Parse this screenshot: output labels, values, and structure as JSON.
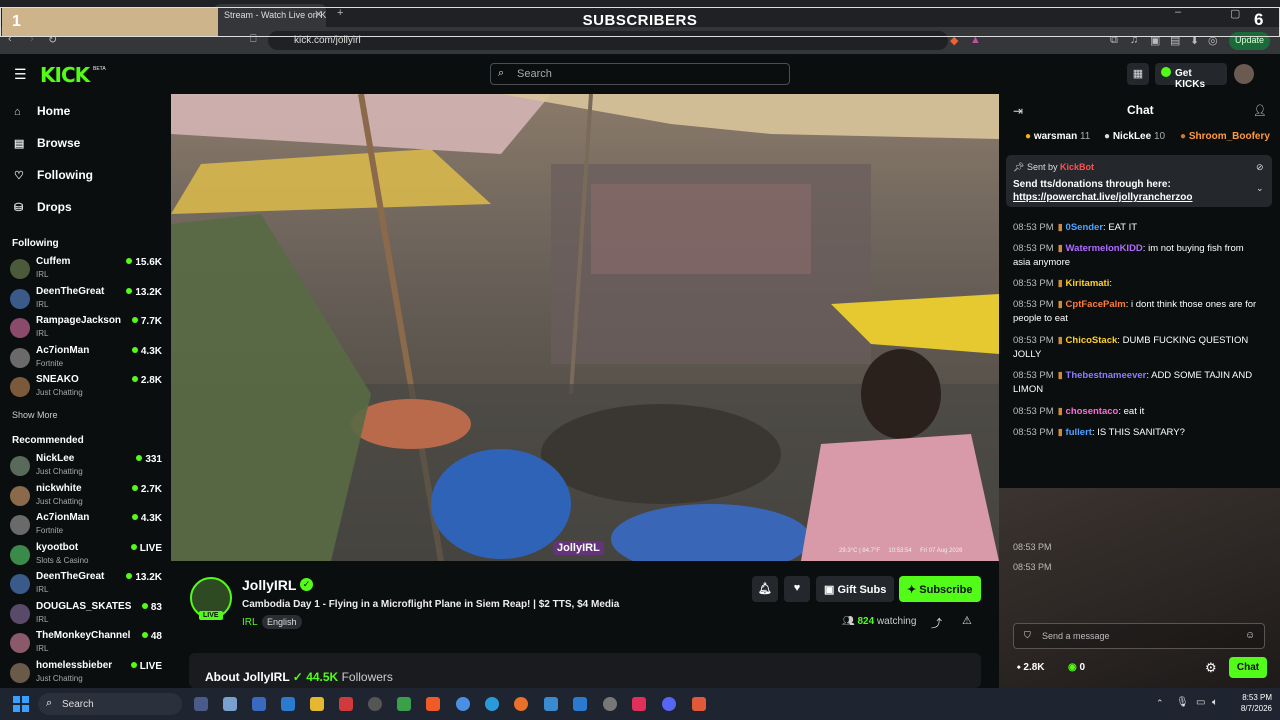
{
  "overlay": {
    "left_number": "1",
    "title": "SUBSCRIBERS",
    "right_number": "6"
  },
  "browser": {
    "tab_title": "Stream - Watch Live on K",
    "url": "kick.com/jollyirl",
    "update_label": "Update"
  },
  "header": {
    "logo": "KICK",
    "logo_badge": "BETA",
    "search_placeholder": "Search",
    "get_kicks_label": "Get KICKs"
  },
  "sidebar": {
    "nav": [
      {
        "label": "Home",
        "icon": "home-icon"
      },
      {
        "label": "Browse",
        "icon": "browse-icon"
      },
      {
        "label": "Following",
        "icon": "heart-icon"
      },
      {
        "label": "Drops",
        "icon": "drops-icon"
      }
    ],
    "following_title": "Following",
    "following": [
      {
        "name": "Cuffem",
        "category": "IRL",
        "viewers": "15.6K",
        "color": "#4a5a3a"
      },
      {
        "name": "DeenTheGreat",
        "category": "IRL",
        "viewers": "13.2K",
        "color": "#3a5a8a"
      },
      {
        "name": "RampageJackson",
        "category": "IRL",
        "viewers": "7.7K",
        "color": "#8a4a6a"
      },
      {
        "name": "Ac7ionMan",
        "category": "Fortnite",
        "viewers": "4.3K",
        "color": "#6a6a6a"
      },
      {
        "name": "SNEAKO",
        "category": "Just Chatting",
        "viewers": "2.8K",
        "color": "#7a5a3a"
      }
    ],
    "show_more": "Show More",
    "recommended_title": "Recommended",
    "recommended": [
      {
        "name": "NickLee",
        "category": "Just Chatting",
        "viewers": "331",
        "color": "#5a6a5a"
      },
      {
        "name": "nickwhite",
        "category": "Just Chatting",
        "viewers": "2.7K",
        "color": "#8a6a4a"
      },
      {
        "name": "Ac7ionMan",
        "category": "Fortnite",
        "viewers": "4.3K",
        "color": "#6a6a6a"
      },
      {
        "name": "kyootbot",
        "category": "Slots & Casino",
        "viewers": "LIVE",
        "color": "#3a8a4a"
      },
      {
        "name": "DeenTheGreat",
        "category": "IRL",
        "viewers": "13.2K",
        "color": "#3a5a8a"
      },
      {
        "name": "DOUGLAS_SKATES",
        "category": "IRL",
        "viewers": "83",
        "color": "#5a4a6a"
      },
      {
        "name": "TheMonkeyChannel",
        "category": "IRL",
        "viewers": "48",
        "color": "#8a5a6a"
      },
      {
        "name": "homelessbieber",
        "category": "Just Chatting",
        "viewers": "LIVE",
        "color": "#6a5a4a"
      }
    ]
  },
  "video": {
    "watermark": "JollyIRL",
    "overlay_info": "29.3°C | 84.7°F     10:53:54     Fri 07 Aug 2026"
  },
  "stream": {
    "streamer": "JollyIRL",
    "live_badge": "LIVE",
    "title": "Cambodia Day 1 - Flying in a Microflight Plane in Siem Reap! | $2 TTS, $4 Media",
    "category": "IRL",
    "language": "English",
    "gift_subs_label": "Gift Subs",
    "subscribe_label": "Subscribe",
    "watching_count": "824",
    "watching_label": "watching",
    "about_label": "About JollyIRL",
    "followers_count": "44.5K",
    "followers_label": "Followers"
  },
  "chat": {
    "title": "Chat",
    "top_gifters": [
      {
        "name": "warsman",
        "count": "11"
      },
      {
        "name": "NickLee",
        "count": "10"
      },
      {
        "name": "Shroom_Boofery",
        "count": ""
      }
    ],
    "pinned": {
      "sent_by_label": "Sent by",
      "sender": "KickBot",
      "line1": "Send tts/donations through here:",
      "link": "https://powerchat.live/jollyrancherzoo"
    },
    "messages": [
      {
        "time": "08:53 PM",
        "user": "0Sender",
        "color": "#4da3ff",
        "text": "EAT IT"
      },
      {
        "time": "08:53 PM",
        "user": "WatermelonKIDD",
        "color": "#b06bff",
        "text": "im not buying fish from asia anymore"
      },
      {
        "time": "08:53 PM",
        "user": "Kiritamati",
        "color": "#ffd21f",
        "text": ""
      },
      {
        "time": "08:53 PM",
        "user": "CptFacePalm",
        "color": "#ff7b3a",
        "text": "i dont think those ones are for people to eat"
      },
      {
        "time": "08:53 PM",
        "user": "ChicoStack",
        "color": "#ffd21f",
        "text": "DUMB FUCKING QUESTION JOLLY"
      },
      {
        "time": "08:53 PM",
        "user": "Thebestnameever",
        "color": "#8c7dff",
        "text": "ADD SOME TAJIN AND LIMON"
      },
      {
        "time": "08:53 PM",
        "user": "chosentaco",
        "color": "#ff6bd5",
        "text": "eat it"
      },
      {
        "time": "08:53 PM",
        "user": "fullert",
        "color": "#4da3ff",
        "text": "IS THIS SANITARY?"
      }
    ],
    "send_placeholder": "Send a message",
    "kicks_count": "2.8K",
    "points_count": "0",
    "chat_button": "Chat"
  },
  "taskbar": {
    "search_label": "Search",
    "time": "8:53 PM",
    "date": "8/7/2026"
  }
}
